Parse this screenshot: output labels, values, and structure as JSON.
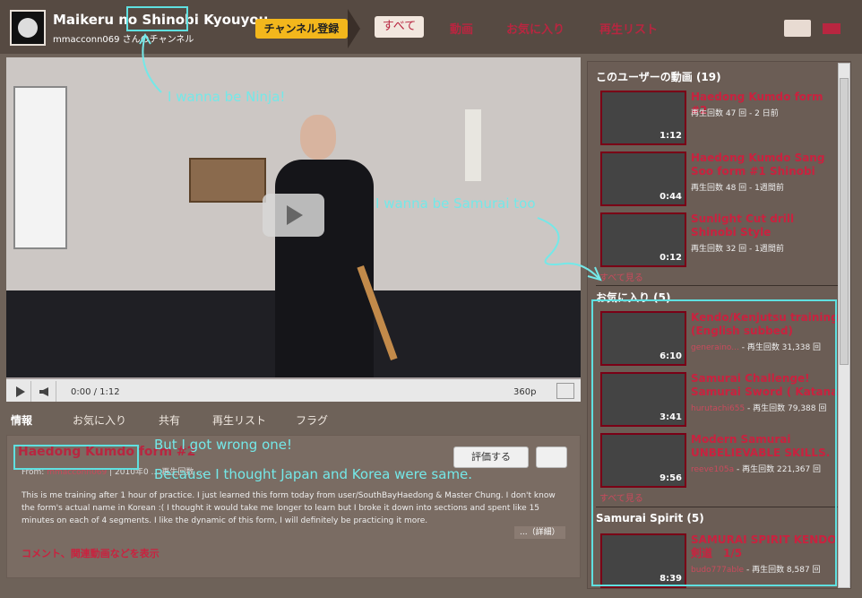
{
  "header": {
    "channel_title": "Maikeru no Shinobi Kyouyou",
    "channel_sub": "mmacconn069 さんのチャンネル",
    "subscribe_label": "チャンネル登録",
    "tabs": [
      "すべて",
      "動画",
      "お気に入り",
      "再生リスト"
    ]
  },
  "player": {
    "time": "0:00 / 1:12",
    "quality": "360p"
  },
  "subtabs": [
    "情報",
    "お気に入り",
    "共有",
    "再生リスト",
    "フラグ"
  ],
  "video_info": {
    "title": "Haedong Kumdo form #2",
    "from_label": "From:",
    "author": "mmacconn069",
    "date_views": "| 2010年0 … 再生回数 …",
    "description": "This is me training after 1 hour of practice. I just learned this form today from user/SouthBayHaedong & Master Chung. I don't know the form's actual name in Korean :( I thought it would take me longer to learn but I broke it down into sections and spent like 15 minutes on each of 4 segments. I like the dynamic of this form, I will definitely be practicing it more.",
    "more_label": "...（詳細）",
    "comments_label": "コメント、関連動画などを表示",
    "rate_label": "評価する"
  },
  "sidebar": {
    "sections": [
      {
        "header": "このユーザーの動画 (19)",
        "items": [
          {
            "title": "Haedong Kumdo form #2",
            "meta": "再生回数 47 回 - 2 日前",
            "author": "",
            "dur": "1:12"
          },
          {
            "title": "Haedong Kumdo Sang Soo form #1 Shinobi",
            "meta": "再生回数 48 回 - 1週間前",
            "author": "",
            "dur": "0:44"
          },
          {
            "title": "Sunlight Cut drill Shinobi Style",
            "meta": "再生回数 32 回 - 1週間前",
            "author": "",
            "dur": "0:12"
          }
        ],
        "see_all": "すべて見る"
      },
      {
        "header": "お気に入り (5)",
        "items": [
          {
            "title": "Kendo/Kenjutsu training (English subbed)",
            "meta": " - 再生回数 31,338 回",
            "author": "generaino...",
            "dur": "6:10"
          },
          {
            "title": "Samurai Challenge! Samurai Sword ( Katana",
            "meta": " - 再生回数 79,388 回",
            "author": "hurutachi655",
            "dur": "3:41"
          },
          {
            "title": "Modern Samurai UNBELIEVABLE SKILLS.",
            "meta": " - 再生回数 221,367 回",
            "author": "reeve105a",
            "dur": "9:56"
          }
        ],
        "see_all": "すべて見る"
      },
      {
        "header": "Samurai Spirit (5)",
        "items": [
          {
            "title": "SAMURAI SPIRIT KENDO 剣道　1/5",
            "meta": " - 再生回数 8,587 回",
            "author": "budo777able",
            "dur": "8:39"
          }
        ]
      }
    ]
  },
  "annotations": {
    "ninja": "I wanna be Ninja!",
    "samurai": "I wanna be Samurai  too",
    "wrong": "But I got wrong one!",
    "because": "Because I thought Japan and Korea were same."
  }
}
